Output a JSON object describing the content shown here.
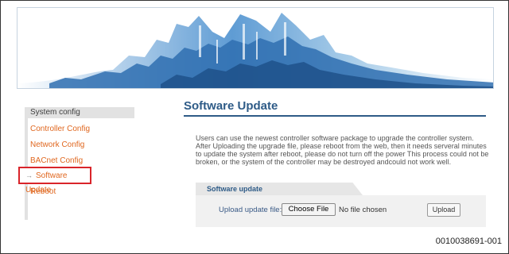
{
  "sidebar": {
    "header": "System config",
    "items": [
      {
        "label": "Controller Config"
      },
      {
        "label": "Network Config"
      },
      {
        "label": "BACnet Config"
      },
      {
        "label": "Software Update",
        "active": true
      },
      {
        "label": "Reboot"
      }
    ],
    "active_marker": "→"
  },
  "main": {
    "title": "Software Update",
    "description": "Users can use the newest controller software package to upgrade the controller system. After Uploading the upgrade file, please reboot from the web, then it needs serveral minutes to update the system after reboot, please do not turn off the power This process could not be broken, or the system of the controller may be destroyed andcould not work well.",
    "panel": {
      "tab_label": "Software update",
      "upload_label": "Upload update file:",
      "choose_button": "Choose File",
      "file_status": "No file chosen",
      "upload_button": "Upload"
    }
  },
  "footer": {
    "doc_id": "0010038691-001"
  },
  "colors": {
    "accent_blue": "#2e5b87",
    "link_orange": "#e0671f",
    "highlight_red": "#d9242a"
  }
}
